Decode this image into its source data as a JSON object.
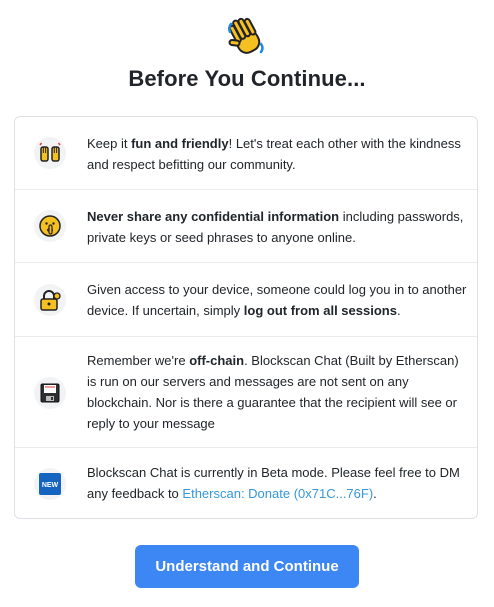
{
  "header": {
    "icon": "waving-hand-icon",
    "title": "Before You Continue..."
  },
  "rules": [
    {
      "icon": "raised-hands-icon",
      "pre": "Keep it ",
      "bold": "fun and friendly",
      "post": "! Let's treat each other with the kindness and respect befitting our community."
    },
    {
      "icon": "shushing-face-icon",
      "pre": "",
      "bold": "Never share any confidential information",
      "post": " including passwords, private keys or seed phrases to anyone online."
    },
    {
      "icon": "locked-with-key-icon",
      "pre": "Given access to your device, someone could log you in to another device. If uncertain, simply ",
      "bold": "log out from all sessions",
      "post": "."
    },
    {
      "icon": "floppy-disk-icon",
      "pre": "Remember we're ",
      "bold": "off-chain",
      "post": ". Blockscan Chat (Built by Etherscan) is run on our servers and messages are not sent on any blockchain. Nor is there a guarantee that the recipient will see or reply to your message"
    },
    {
      "icon": "new-button-icon",
      "icon_text": "NEW",
      "pre": "Blockscan Chat is currently in Beta mode. Please feel free to DM any feedback to ",
      "link": "Etherscan: Donate (0x71C...76F)",
      "post": "."
    }
  ],
  "actions": {
    "continue_label": "Understand and Continue"
  },
  "colors": {
    "primary": "#3d87f5",
    "link": "#3498db",
    "border": "#dee2e6"
  }
}
